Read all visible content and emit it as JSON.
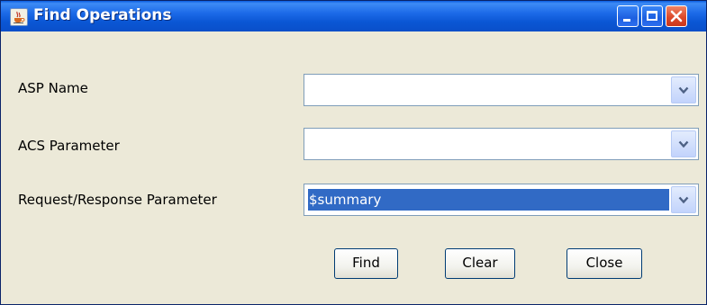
{
  "window": {
    "title": "Find Operations"
  },
  "form": {
    "fields": [
      {
        "label": "ASP Name",
        "value": ""
      },
      {
        "label": "ACS Parameter",
        "value": ""
      },
      {
        "label": "Request/Response Parameter",
        "value": "$summary"
      }
    ]
  },
  "buttons": {
    "find": "Find",
    "clear": "Clear",
    "close": "Close"
  },
  "icons": {
    "title": "java-cup-icon",
    "minimize": "minimize-icon",
    "maximize": "maximize-icon",
    "close": "close-icon",
    "dropdown": "chevron-down-icon"
  },
  "colors": {
    "titlebar": "#0a56d4",
    "selection": "#316ac5",
    "close_button": "#dd4a2b",
    "dialog_background": "#ece9d8"
  }
}
